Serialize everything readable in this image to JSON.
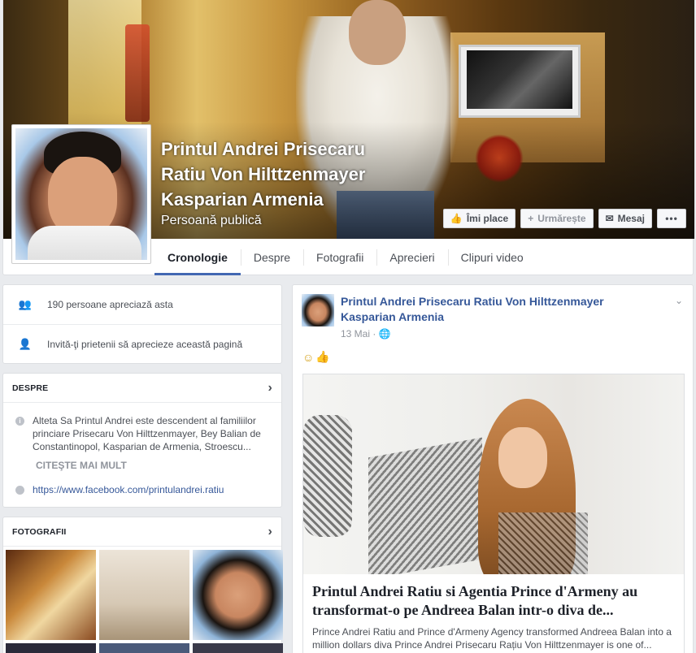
{
  "page": {
    "name_line1": "Printul Andrei Prisecaru",
    "name_line2": "Ratiu Von Hilttzenmayer",
    "name_line3": "Kasparian Armenia",
    "category": "Persoană publică"
  },
  "cover_buttons": {
    "like": "Îmi place",
    "follow": "Urmărește",
    "message": "Mesaj",
    "more": "•••"
  },
  "tabs": [
    "Cronologie",
    "Despre",
    "Fotografii",
    "Aprecieri",
    "Clipuri video"
  ],
  "likes": {
    "count_text": "190 persoane apreciază asta",
    "invite_text": "Invită-ţi prietenii să aprecieze această pagină"
  },
  "about": {
    "title": "DESPRE",
    "description": "Alteta Sa Printul Andrei este descendent al familiilor princiare Prisecaru Von Hilttzenmayer, Bey Balian de Constantinopol, Kasparian de Armenia, Stroescu...",
    "see_more": "CITEŞTE MAI MULT",
    "url": "https://www.facebook.com/printulandrei.ratiu"
  },
  "photos": {
    "title": "FOTOGRAFII"
  },
  "post": {
    "author_line1": "Printul Andrei Prisecaru Ratiu Von Hilttzenmayer",
    "author_line2": "Kasparian Armenia",
    "date": "13 Mai",
    "privacy_glyph": "🌐",
    "chevron": "⌄",
    "link_title": "Printul Andrei Ratiu si Agentia Prince d'Armeny au transformat-o pe Andreea Balan intr-o diva de...",
    "link_desc": "Prince Andrei Ratiu and Prince d'Armeny Agency transformed Andreea Balan into a million dollars diva Prince Andrei Prisecaru Rațiu Von Hilttzenmayer is one of..."
  },
  "colors": {
    "accent": "#4267b2",
    "link": "#365899",
    "background": "#e9ebee"
  }
}
